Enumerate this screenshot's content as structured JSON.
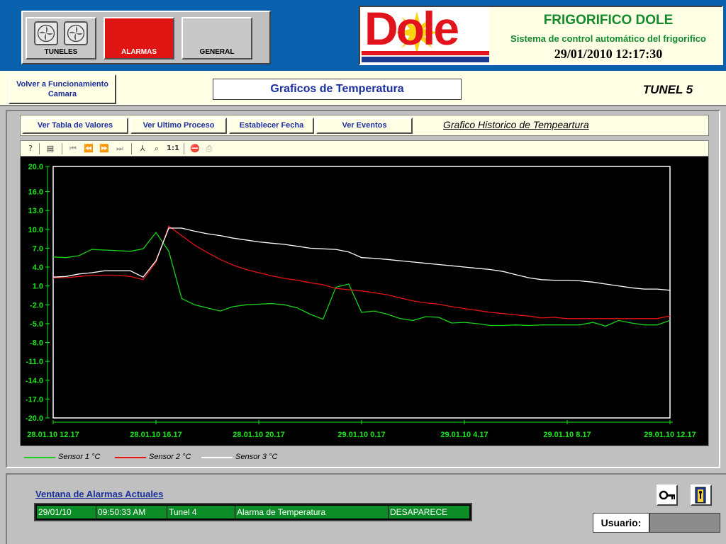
{
  "nav": {
    "tuneles_label": "TUNELES",
    "alarmas_label": "ALARMAS",
    "general_label": "GENERAL"
  },
  "brand": {
    "logo_text": "Dole",
    "title": "FRIGORIFICO DOLE",
    "subtitle": "Sistema de control automático del frigorifico",
    "datetime": "29/01/2010 12:17:30"
  },
  "titlebar": {
    "back_label_1": "Volver a Funcionamiento",
    "back_label_2": "Camara",
    "page_title": "Graficos de Temperatura",
    "tunnel": "TUNEL 5"
  },
  "toolbar": {
    "ver_tabla": "Ver Tabla de Valores",
    "ver_ultimo": "Ver Ultimo Proceso",
    "establecer_fecha": "Establecer Fecha",
    "ver_eventos": "Ver Eventos",
    "hist_title": "Grafico Historico de Tempeartura"
  },
  "chart_tools": [
    {
      "icon": "help-icon",
      "glyph": "?"
    },
    {
      "icon": "table-icon",
      "glyph": "▤"
    },
    {
      "icon": "first-icon",
      "glyph": "⏮"
    },
    {
      "icon": "rewind-icon",
      "glyph": "⏪"
    },
    {
      "icon": "forward-icon",
      "glyph": "⏩"
    },
    {
      "icon": "last-icon",
      "glyph": "⏭"
    },
    {
      "icon": "scale-icon",
      "glyph": "⅄"
    },
    {
      "icon": "zoom-icon",
      "glyph": "⌕"
    },
    {
      "icon": "zoom-reset-icon",
      "glyph": "1:1"
    },
    {
      "icon": "stop-icon",
      "glyph": "⛔"
    },
    {
      "icon": "print-icon",
      "glyph": "⎙"
    }
  ],
  "chart_data": {
    "type": "line",
    "background": "#000000",
    "ylim": [
      -20.0,
      20.0
    ],
    "yticks": [
      "20.0",
      "16.0",
      "13.0",
      "10.0",
      "7.0",
      "4.0",
      "1.0",
      "-2.0",
      "-5.0",
      "-8.0",
      "-11.0",
      "-14.0",
      "-17.0",
      "-20.0"
    ],
    "ytick_values": [
      20,
      16,
      13,
      10,
      7,
      4,
      1,
      -2,
      -5,
      -8,
      -11,
      -14,
      -17,
      -20
    ],
    "xticks": [
      "28.01.10 12.17",
      "28.01.10 16.17",
      "28.01.10 20.17",
      "29.01.10 0.17",
      "29.01.10 4.17",
      "29.01.10 8.17",
      "29.01.10 12.17"
    ],
    "xlim_hours": [
      0,
      24
    ],
    "tick_color": "#19e619",
    "grid": false,
    "legend": "bottom-left",
    "series": [
      {
        "name": "Sensor 1 °C",
        "color": "#19d219",
        "points": [
          [
            0,
            5.6
          ],
          [
            0.5,
            5.5
          ],
          [
            1,
            5.8
          ],
          [
            1.5,
            6.8
          ],
          [
            2,
            6.7
          ],
          [
            2.5,
            6.6
          ],
          [
            3,
            6.5
          ],
          [
            3.5,
            6.9
          ],
          [
            4,
            9.5
          ],
          [
            4.5,
            6.5
          ],
          [
            5,
            -1
          ],
          [
            5.5,
            -2
          ],
          [
            6,
            -2.5
          ],
          [
            6.5,
            -3
          ],
          [
            7,
            -2.3
          ],
          [
            7.5,
            -2
          ],
          [
            8,
            -1.9
          ],
          [
            8.5,
            -1.8
          ],
          [
            9,
            -2
          ],
          [
            9.5,
            -2.5
          ],
          [
            10,
            -3.5
          ],
          [
            10.5,
            -4.3
          ],
          [
            11,
            0.8
          ],
          [
            11.5,
            1.3
          ],
          [
            12,
            -3.2
          ],
          [
            12.5,
            -3
          ],
          [
            13,
            -3.5
          ],
          [
            13.5,
            -4.2
          ],
          [
            14,
            -4.5
          ],
          [
            14.5,
            -3.9
          ],
          [
            15,
            -4
          ],
          [
            15.5,
            -4.9
          ],
          [
            16,
            -4.8
          ],
          [
            16.5,
            -5
          ],
          [
            17,
            -5.3
          ],
          [
            17.5,
            -5.3
          ],
          [
            18,
            -5.2
          ],
          [
            18.5,
            -5.3
          ],
          [
            19,
            -5.2
          ],
          [
            19.5,
            -5.2
          ],
          [
            20,
            -5.2
          ],
          [
            20.5,
            -5.2
          ],
          [
            21,
            -4.8
          ],
          [
            21.5,
            -5.4
          ],
          [
            22,
            -4.5
          ],
          [
            22.5,
            -4.9
          ],
          [
            23,
            -5.2
          ],
          [
            23.5,
            -5.2
          ],
          [
            24,
            -4.5
          ]
        ]
      },
      {
        "name": "Sensor 2 °C",
        "color": "#e61414",
        "points": [
          [
            0,
            2.3
          ],
          [
            0.5,
            2.3
          ],
          [
            1,
            2.5
          ],
          [
            1.5,
            2.7
          ],
          [
            2,
            2.7
          ],
          [
            2.5,
            2.7
          ],
          [
            3,
            2.5
          ],
          [
            3.5,
            2
          ],
          [
            4,
            4.8
          ],
          [
            4.5,
            10.5
          ],
          [
            5,
            9
          ],
          [
            5.5,
            7.5
          ],
          [
            6,
            6.3
          ],
          [
            6.5,
            5.2
          ],
          [
            7,
            4.3
          ],
          [
            7.5,
            3.6
          ],
          [
            8,
            3.1
          ],
          [
            8.5,
            2.6
          ],
          [
            9,
            2.2
          ],
          [
            9.5,
            1.9
          ],
          [
            10,
            1.5
          ],
          [
            10.5,
            1.2
          ],
          [
            11,
            0.6
          ],
          [
            11.5,
            0.4
          ],
          [
            12,
            0.2
          ],
          [
            12.5,
            -0.1
          ],
          [
            13,
            -0.4
          ],
          [
            13.5,
            -0.9
          ],
          [
            14,
            -1.4
          ],
          [
            14.5,
            -1.7
          ],
          [
            15,
            -1.9
          ],
          [
            15.5,
            -2.3
          ],
          [
            16,
            -2.6
          ],
          [
            16.5,
            -2.9
          ],
          [
            17,
            -3.2
          ],
          [
            17.5,
            -3.4
          ],
          [
            18,
            -3.6
          ],
          [
            18.5,
            -3.8
          ],
          [
            19,
            -4.1
          ],
          [
            19.5,
            -4.0
          ],
          [
            20,
            -4.2
          ],
          [
            20.5,
            -4.2
          ],
          [
            21,
            -4.2
          ],
          [
            21.5,
            -4.2
          ],
          [
            22,
            -4.2
          ],
          [
            22.5,
            -4.2
          ],
          [
            23,
            -4.2
          ],
          [
            23.5,
            -4.2
          ],
          [
            24,
            -3.8
          ]
        ]
      },
      {
        "name": "Sensor 3 °C",
        "color": "#ffffff",
        "points": [
          [
            0,
            2.4
          ],
          [
            0.5,
            2.5
          ],
          [
            1,
            2.9
          ],
          [
            1.5,
            3.1
          ],
          [
            2,
            3.4
          ],
          [
            2.5,
            3.4
          ],
          [
            3,
            3.4
          ],
          [
            3.5,
            2.4
          ],
          [
            4,
            5
          ],
          [
            4.5,
            10.2
          ],
          [
            5,
            10.2
          ],
          [
            5.5,
            9.7
          ],
          [
            6,
            9.3
          ],
          [
            6.5,
            9
          ],
          [
            7,
            8.6
          ],
          [
            7.5,
            8.3
          ],
          [
            8,
            8
          ],
          [
            8.5,
            7.8
          ],
          [
            9,
            7.6
          ],
          [
            9.5,
            7.3
          ],
          [
            10,
            7
          ],
          [
            10.5,
            6.9
          ],
          [
            11,
            6.8
          ],
          [
            11.5,
            6.4
          ],
          [
            12,
            5.5
          ],
          [
            12.5,
            5.4
          ],
          [
            13,
            5.2
          ],
          [
            13.5,
            5
          ],
          [
            14,
            4.8
          ],
          [
            14.5,
            4.6
          ],
          [
            15,
            4.4
          ],
          [
            15.5,
            4.2
          ],
          [
            16,
            4
          ],
          [
            16.5,
            3.8
          ],
          [
            17,
            3.6
          ],
          [
            17.5,
            3.3
          ],
          [
            18,
            2.8
          ],
          [
            18.5,
            2.3
          ],
          [
            19,
            2
          ],
          [
            19.5,
            1.9
          ],
          [
            20,
            1.9
          ],
          [
            20.5,
            1.8
          ],
          [
            21,
            1.6
          ],
          [
            21.5,
            1.3
          ],
          [
            22,
            1
          ],
          [
            22.5,
            0.7
          ],
          [
            23,
            0.5
          ],
          [
            23.5,
            0.5
          ],
          [
            24,
            0.3
          ]
        ]
      }
    ]
  },
  "legend": [
    {
      "label": "Sensor 1 °C",
      "color": "#19d219"
    },
    {
      "label": "Sensor 2 °C",
      "color": "#e61414"
    },
    {
      "label": "Sensor 3 °C",
      "color": "#ffffff"
    }
  ],
  "alarms": {
    "link": "Ventana de Alarmas Actuales",
    "row": {
      "date": "29/01/10",
      "time": "09:50:33 AM",
      "tunnel": "Tunel 4",
      "message": "Alarma de Temperatura",
      "status": "DESAPARECE"
    }
  },
  "user": {
    "label": "Usuario:",
    "value": ""
  }
}
